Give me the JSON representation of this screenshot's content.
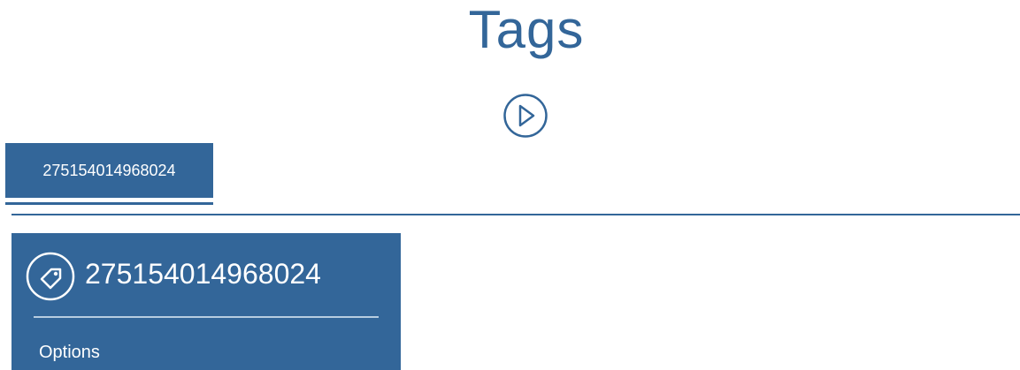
{
  "header": {
    "title": "Tags"
  },
  "controls": {
    "play_icon": "play-circle-icon"
  },
  "tabs": [
    {
      "label": "275154014968024",
      "active": true
    }
  ],
  "tag_card": {
    "icon": "tag-icon",
    "title": "275154014968024",
    "options_label": "Options"
  },
  "colors": {
    "accent": "#336699",
    "background": "#ffffff",
    "text_on_accent": "#ffffff",
    "divider_on_accent": "#b8cde0"
  }
}
